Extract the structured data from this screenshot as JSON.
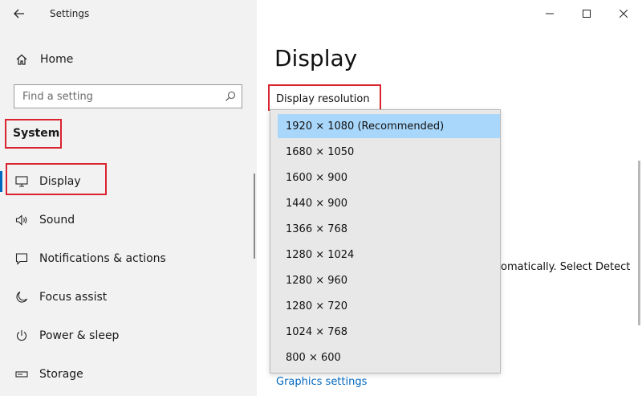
{
  "window": {
    "title": "Settings",
    "controls": [
      "minimize",
      "maximize",
      "close"
    ]
  },
  "sidebar": {
    "home_label": "Home",
    "search_placeholder": "Find a setting",
    "section_title": "System",
    "items": [
      {
        "label": "Display",
        "icon": "monitor-icon",
        "active": true
      },
      {
        "label": "Sound",
        "icon": "speaker-icon",
        "active": false
      },
      {
        "label": "Notifications & actions",
        "icon": "notification-icon",
        "active": false
      },
      {
        "label": "Focus assist",
        "icon": "moon-icon",
        "active": false
      },
      {
        "label": "Power & sleep",
        "icon": "power-icon",
        "active": false
      },
      {
        "label": "Storage",
        "icon": "storage-icon",
        "active": false
      }
    ]
  },
  "main": {
    "page_title": "Display",
    "resolution_label": "Display resolution",
    "partial_text": "omatically. Select Detect",
    "graphics_link": "Graphics settings"
  },
  "resolution_dropdown": {
    "selected_index": 0,
    "options": [
      "1920 × 1080 (Recommended)",
      "1680 × 1050",
      "1600 × 900",
      "1440 × 900",
      "1366 × 768",
      "1280 × 1024",
      "1280 × 960",
      "1280 × 720",
      "1024 × 768",
      "800 × 600"
    ]
  },
  "colors": {
    "accent": "#0067c0",
    "highlight_box": "#d9232e",
    "selected_option": "#a9d7fb",
    "sidebar_bg": "#f2f2f2"
  }
}
